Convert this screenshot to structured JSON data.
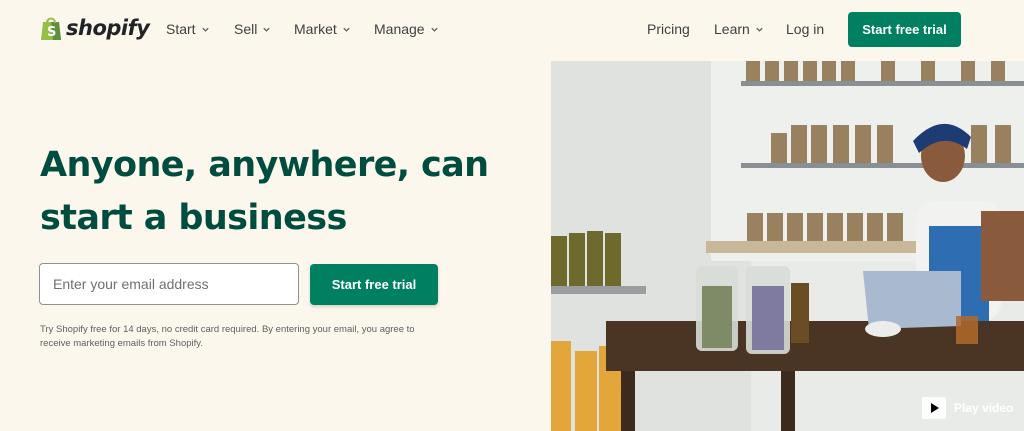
{
  "brand": {
    "name": "shopify",
    "color": "#95bf47"
  },
  "nav": {
    "left": [
      {
        "label": "Start"
      },
      {
        "label": "Sell"
      },
      {
        "label": "Market"
      },
      {
        "label": "Manage"
      }
    ],
    "pricing": "Pricing",
    "learn": "Learn",
    "login": "Log in",
    "cta": "Start free trial"
  },
  "hero": {
    "title_line1": "Anyone, anywhere, can",
    "title_line2": "start a business",
    "email_placeholder": "Enter your email address",
    "cta": "Start free trial",
    "disclaimer": "Try Shopify free for 14 days, no credit card required. By entering your email, you agree to receive marketing emails from Shopify."
  },
  "video": {
    "label": "Play video"
  },
  "colors": {
    "accent": "#008060",
    "heading": "#004c3f",
    "background": "#fbf7ed"
  }
}
